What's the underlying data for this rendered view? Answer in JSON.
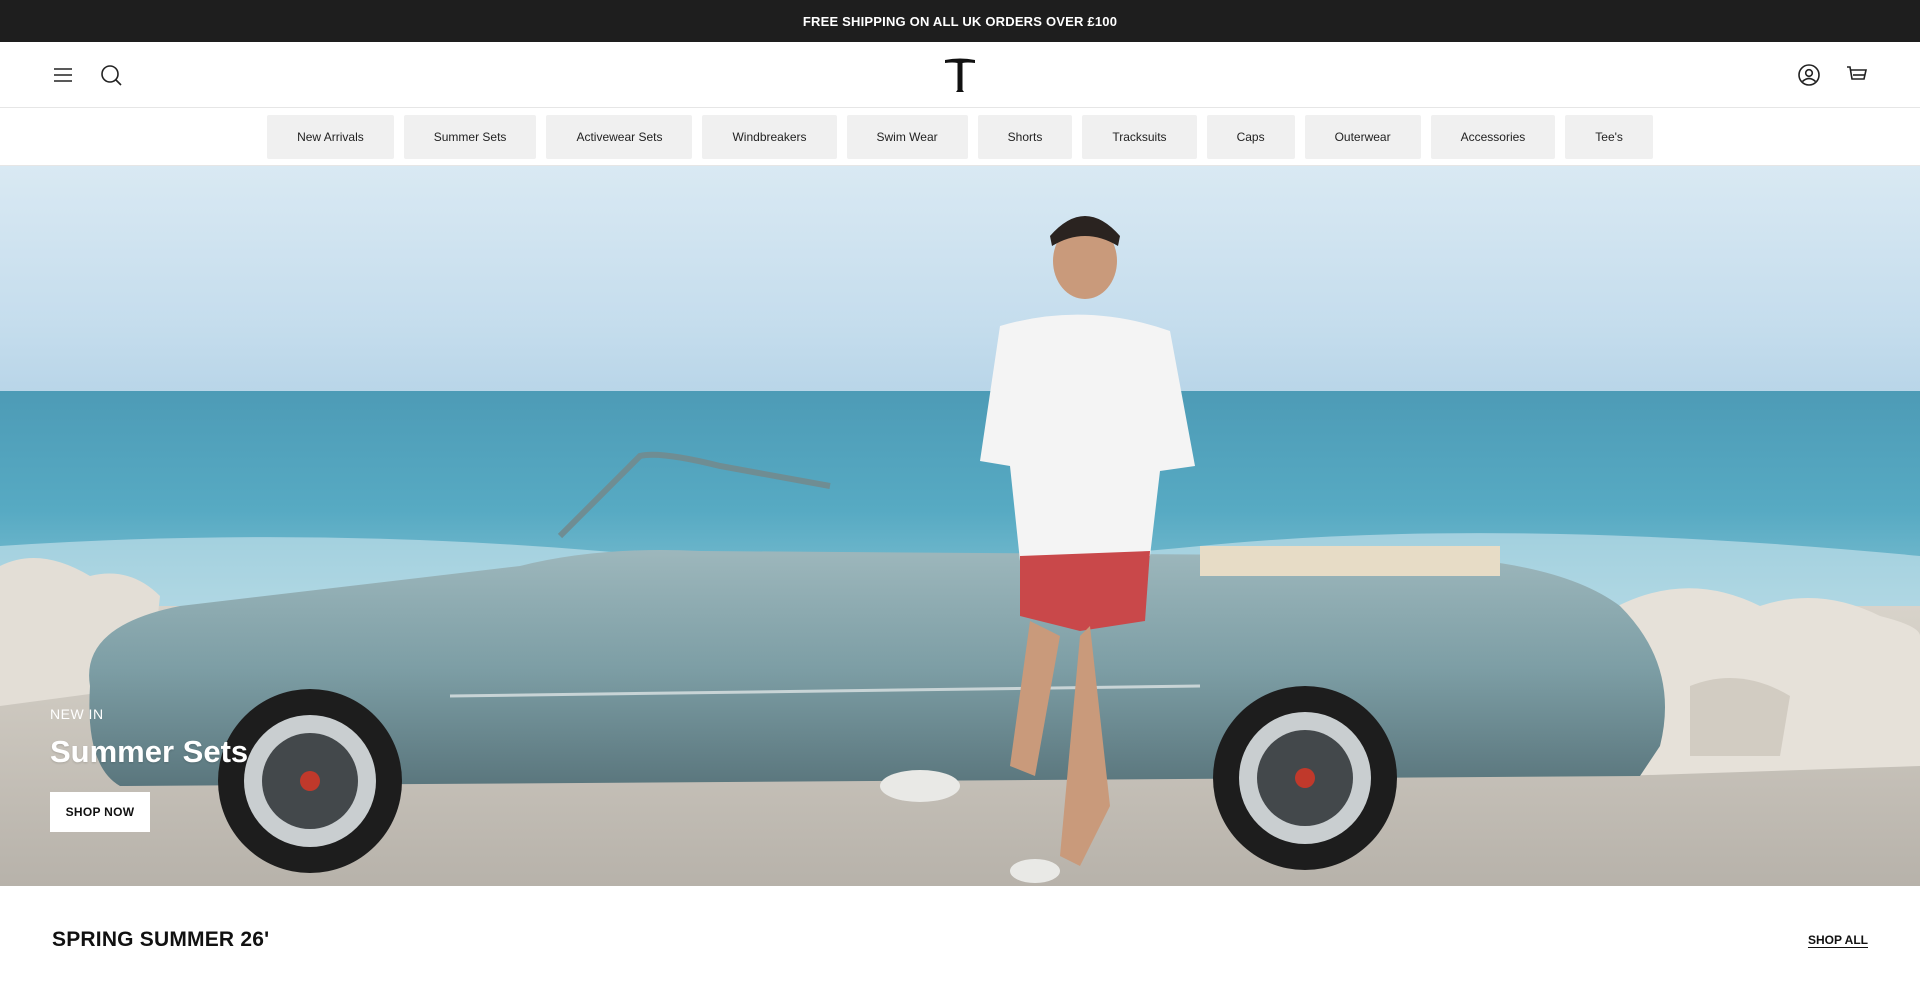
{
  "announcement": {
    "text": "FREE SHIPPING ON ALL UK ORDERS OVER £100"
  },
  "header": {
    "menu_icon": "hamburger-menu-icon",
    "search_icon": "search-icon",
    "logo_icon": "brand-t-logo",
    "account_icon": "account-icon",
    "cart_icon": "cart-icon"
  },
  "categories": [
    "New Arrivals",
    "Summer Sets",
    "Activewear Sets",
    "Windbreakers",
    "Swim Wear",
    "Shorts",
    "Tracksuits",
    "Caps",
    "Outerwear",
    "Accessories",
    "Tee's"
  ],
  "hero": {
    "eyebrow": "NEW IN",
    "title": "Summer Sets",
    "button_label": "SHOP NOW"
  },
  "section": {
    "title": "SPRING SUMMER 26'",
    "link_label": "SHOP ALL"
  },
  "colors": {
    "announcement_bg": "#1e1e1e",
    "pill_bg": "#f0f0f0",
    "car": "#7f9ea5"
  }
}
